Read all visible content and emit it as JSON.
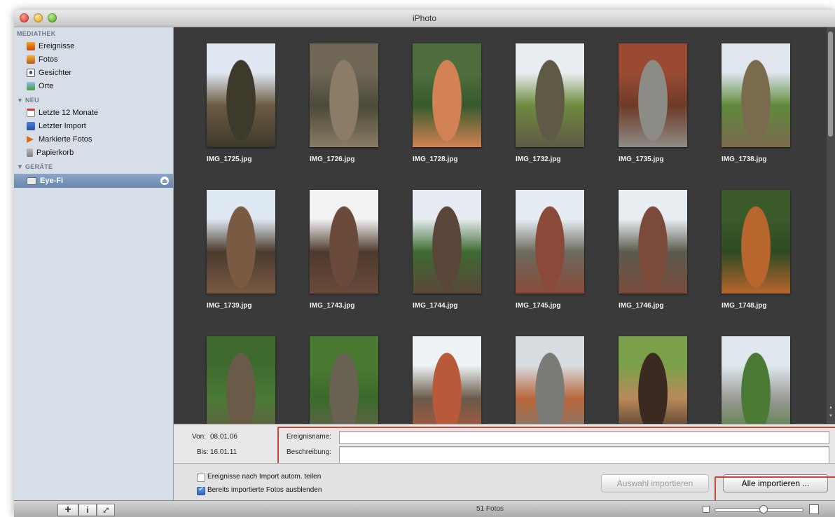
{
  "window": {
    "title": "iPhoto"
  },
  "sidebar": {
    "sections": [
      {
        "label": "MEDIATHEK",
        "items": [
          {
            "label": "Ereignisse",
            "icon": "events-icon"
          },
          {
            "label": "Fotos",
            "icon": "photos-icon"
          },
          {
            "label": "Gesichter",
            "icon": "faces-icon"
          },
          {
            "label": "Orte",
            "icon": "places-icon"
          }
        ]
      },
      {
        "label": "▼ NEU",
        "items": [
          {
            "label": "Letzte 12 Monate",
            "icon": "calendar-icon"
          },
          {
            "label": "Letzter Import",
            "icon": "import-icon"
          },
          {
            "label": "Markierte Fotos",
            "icon": "flag-icon"
          },
          {
            "label": "Papierkorb",
            "icon": "trash-icon"
          }
        ]
      },
      {
        "label": "▼ GERÄTE",
        "items": [
          {
            "label": "Eye-Fi",
            "icon": "camera-icon",
            "selected": true
          }
        ]
      }
    ],
    "eject_glyph": "⏏"
  },
  "photos": [
    {
      "name": "IMG_1725.jpg",
      "colors": [
        "#dfe8f2",
        "#3d3a2c",
        "#6b5a42"
      ]
    },
    {
      "name": "IMG_1726.jpg",
      "colors": [
        "#6f6656",
        "#8a7c66",
        "#4b4a38"
      ]
    },
    {
      "name": "IMG_1728.jpg",
      "colors": [
        "#4f6e3e",
        "#d28254",
        "#365a2c"
      ]
    },
    {
      "name": "IMG_1732.jpg",
      "colors": [
        "#e9eef2",
        "#5f5a46",
        "#6e8a3e"
      ]
    },
    {
      "name": "IMG_1735.jpg",
      "colors": [
        "#9a4a32",
        "#8d8b85",
        "#6e3a28"
      ]
    },
    {
      "name": "IMG_1738.jpg",
      "colors": [
        "#dfe6ee",
        "#7a6a4e",
        "#5f8a3a"
      ]
    },
    {
      "name": "IMG_1739.jpg",
      "colors": [
        "#dde8f3",
        "#7a5a42",
        "#4a3a2e"
      ]
    },
    {
      "name": "IMG_1743.jpg",
      "colors": [
        "#f2f2f2",
        "#6a4a3a",
        "#4d3a2e"
      ]
    },
    {
      "name": "IMG_1744.jpg",
      "colors": [
        "#e6ecf1",
        "#5a4638",
        "#3e6a32"
      ]
    },
    {
      "name": "IMG_1745.jpg",
      "colors": [
        "#e6edf2",
        "#8a4a3a",
        "#6b6a5e"
      ]
    },
    {
      "name": "IMG_1746.jpg",
      "colors": [
        "#e8eef2",
        "#7a4a3a",
        "#5a5a4e"
      ]
    },
    {
      "name": "IMG_1748.jpg",
      "colors": [
        "#3a5a2a",
        "#b8662e",
        "#2e4a22"
      ]
    },
    {
      "name": "",
      "colors": [
        "#3e6a2e",
        "#6a5a48",
        "#4a7a36"
      ]
    },
    {
      "name": "",
      "colors": [
        "#4a7a32",
        "#6a6252",
        "#3a6a2a"
      ]
    },
    {
      "name": "",
      "colors": [
        "#eef2f4",
        "#b85a3a",
        "#6a5a4a"
      ]
    },
    {
      "name": "",
      "colors": [
        "#d8dde2",
        "#7a7a76",
        "#b8663a"
      ]
    },
    {
      "name": "",
      "colors": [
        "#7aa04a",
        "#3a2a22",
        "#b88a5a"
      ]
    },
    {
      "name": "",
      "colors": [
        "#dfe8ee",
        "#4a7a36",
        "#9a9a96"
      ]
    }
  ],
  "import_info": {
    "from_label": "Von:",
    "from_value": "08.01.06",
    "to_label": "Bis:",
    "to_value": "16.01.11",
    "event_name_label": "Ereignisname:",
    "event_name_value": "",
    "description_label": "Beschreibung:",
    "description_value": ""
  },
  "options": {
    "split_events_label": "Ereignisse nach Import autom. teilen",
    "split_events_checked": false,
    "hide_imported_label": "Bereits importierte Fotos ausblenden",
    "hide_imported_checked": true,
    "import_selected_label": "Auswahl importieren",
    "import_all_label": "Alle importieren ..."
  },
  "status": {
    "add_glyph": "+",
    "info_glyph": "i",
    "fullscreen_glyph": "⤢",
    "count": "51 Fotos",
    "zoom_level": 0.55
  },
  "colors": {
    "highlight": "#c9463c",
    "selection": "#7390b8",
    "grid_bg": "#3a3a3a"
  }
}
